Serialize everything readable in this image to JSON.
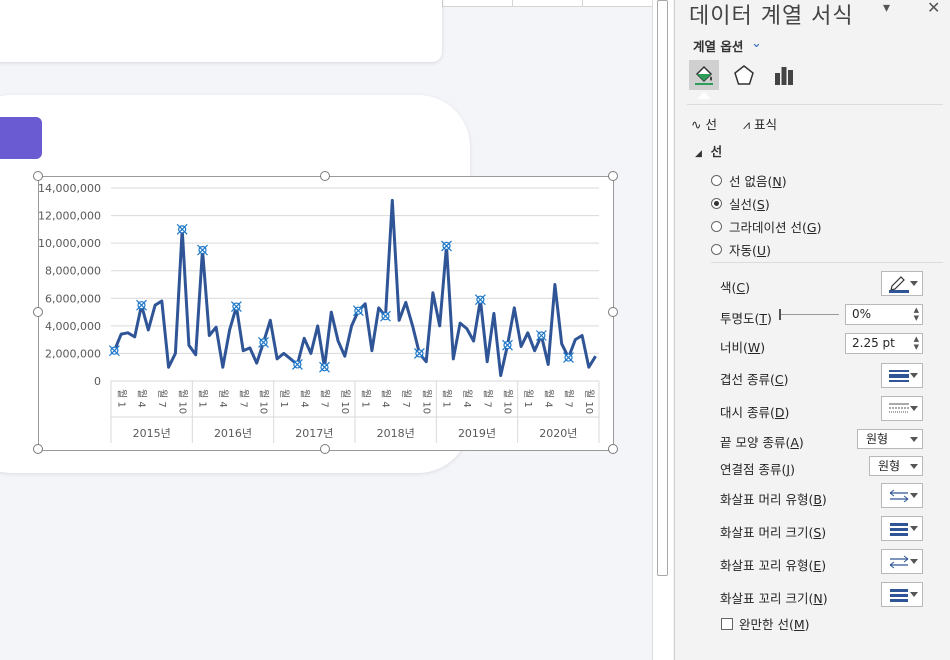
{
  "chart_data": {
    "type": "line",
    "ylim": [
      0,
      14000000
    ],
    "y_ticks": [
      "14,000,000",
      "12,000,000",
      "10,000,000",
      "8,000,000",
      "6,000,000",
      "4,000,000",
      "2,000,000",
      "0"
    ],
    "month_labels": [
      "월 1",
      "월 4",
      "월 7",
      "월 10"
    ],
    "years": [
      "2015년",
      "2016년",
      "2017년",
      "2018년",
      "2019년",
      "2020년"
    ],
    "series": [
      {
        "color": "#2f5597",
        "values": [
          2200000,
          3400000,
          3500000,
          3200000,
          5500000,
          3700000,
          5500000,
          5800000,
          1000000,
          2000000,
          11000000,
          2600000,
          1900000,
          9500000,
          3300000,
          3900000,
          1000000,
          3700000,
          5400000,
          2200000,
          2400000,
          1300000,
          2800000,
          4400000,
          1600000,
          2000000,
          1600000,
          1200000,
          3100000,
          2000000,
          4000000,
          1000000,
          5000000,
          2900000,
          1800000,
          4000000,
          5100000,
          5600000,
          2200000,
          5300000,
          4700000,
          13100000,
          4400000,
          5700000,
          4000000,
          2000000,
          1400000,
          6400000,
          4000000,
          9800000,
          1600000,
          4200000,
          3800000,
          2900000,
          5900000,
          1400000,
          4900000,
          400000,
          2600000,
          5300000,
          2500000,
          3500000,
          2200000,
          3300000,
          1200000,
          7000000,
          2700000,
          1700000,
          3000000,
          3300000,
          1000000,
          1800000
        ],
        "marked_indices": [
          0,
          4,
          10,
          13,
          18,
          22,
          27,
          31,
          36,
          40,
          45,
          49,
          54,
          58,
          63,
          67
        ]
      }
    ]
  },
  "pane": {
    "title": "데이터 계열 서식",
    "series_options": "계열 옵션",
    "tabs": {
      "line": "선",
      "marker": "표식"
    },
    "section_line": "선",
    "radios": [
      {
        "label": "선 없음",
        "key": "N",
        "checked": false
      },
      {
        "label": "실선",
        "key": "S",
        "checked": true
      },
      {
        "label": "그라데이션 선",
        "key": "G",
        "checked": false
      },
      {
        "label": "자동",
        "key": "U",
        "checked": false
      }
    ],
    "color_label": "색",
    "color_key": "C",
    "transparency_label": "투명도",
    "transparency_key": "T",
    "transparency_value": "0%",
    "width_label": "너비",
    "width_key": "W",
    "width_value": "2.25 pt",
    "compound_label": "겹선 종류",
    "compound_key": "C",
    "dash_label": "대시 종류",
    "dash_key": "D",
    "cap_label": "끝 모양 종류",
    "cap_key": "A",
    "cap_value": "원형",
    "join_label": "연결점 종류",
    "join_key": "J",
    "join_value": "원형",
    "begin_arrow_type_label": "화살표 머리 유형",
    "begin_arrow_type_key": "B",
    "begin_arrow_size_label": "화살표 머리 크기",
    "begin_arrow_size_key": "S",
    "end_arrow_type_label": "화살표 꼬리 유형",
    "end_arrow_type_key": "E",
    "end_arrow_size_label": "화살표 꼬리 크기",
    "end_arrow_size_key": "N",
    "smooth_label": "완만한 선",
    "smooth_key": "M",
    "colors": {
      "line_color": "#2f5597",
      "accent": "#2a6bb8"
    }
  }
}
